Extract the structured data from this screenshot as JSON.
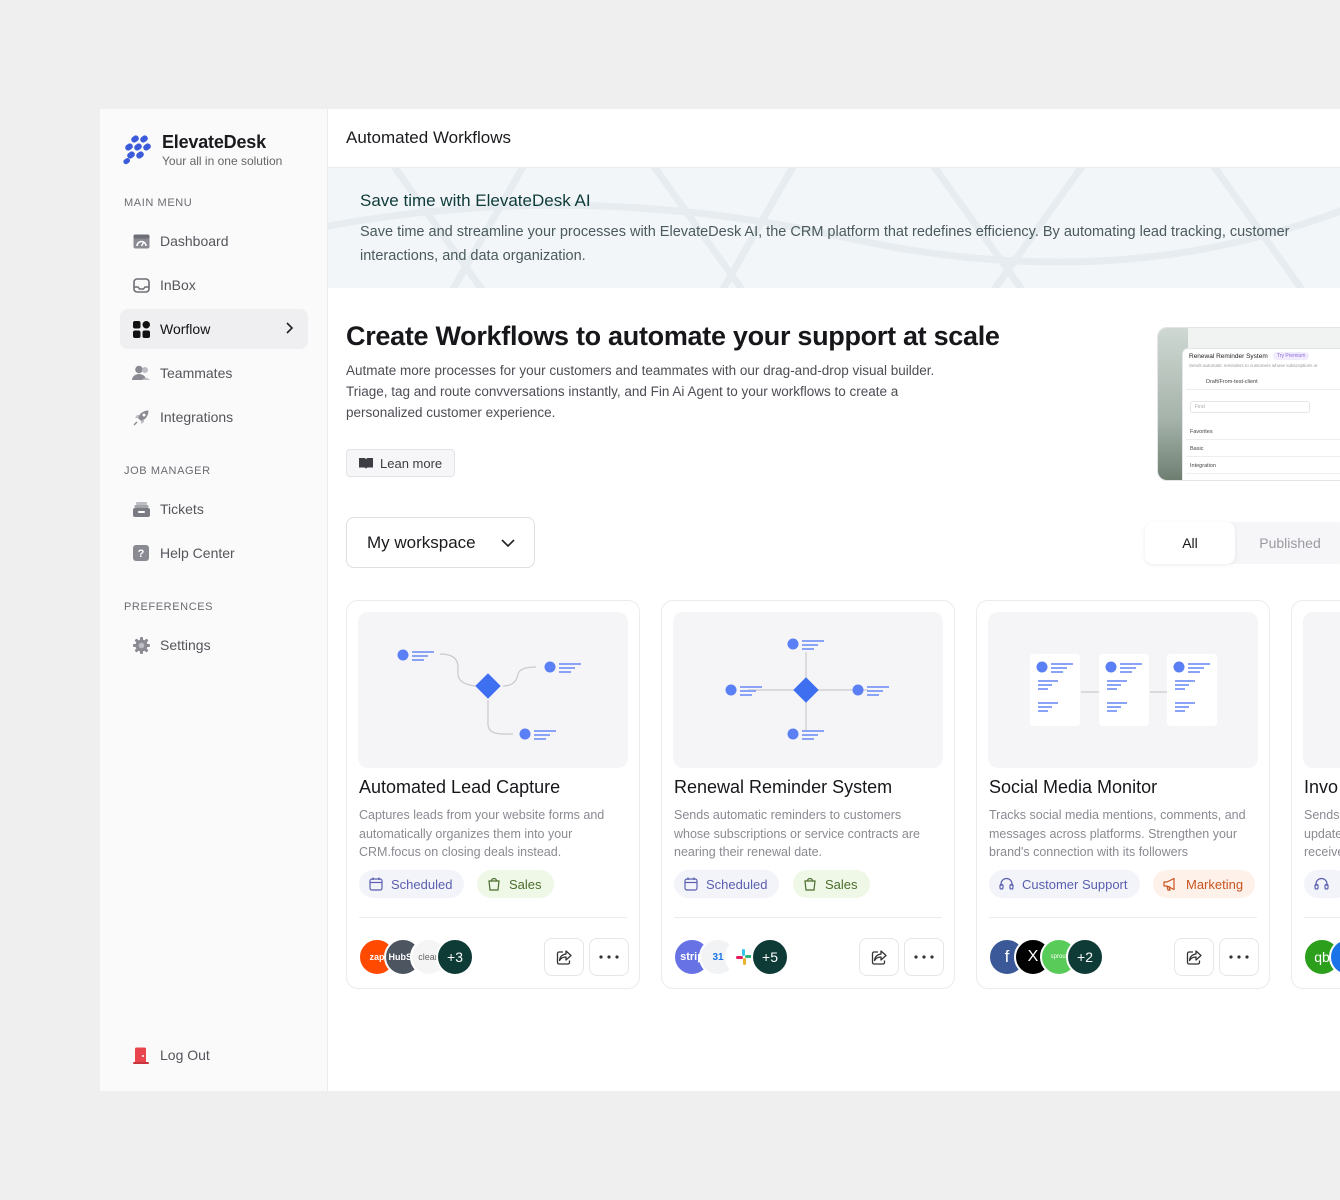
{
  "brand": {
    "name": "ElevateDesk",
    "tagline": "Your all in one solution",
    "accent": "#3b5bdb"
  },
  "sidebar": {
    "sections": [
      {
        "title": "MAIN MENU"
      },
      {
        "title": "JOB MANAGER"
      },
      {
        "title": "PREFERENCES"
      }
    ],
    "items": [
      {
        "label": "Dashboard",
        "icon": "dashboard-icon"
      },
      {
        "label": "InBox",
        "icon": "inbox-icon"
      },
      {
        "label": "Worflow",
        "icon": "workflow-grid-icon",
        "active": true
      },
      {
        "label": "Teammates",
        "icon": "users-icon"
      },
      {
        "label": "Integrations",
        "icon": "rocket-icon"
      },
      {
        "label": "Tickets",
        "icon": "tickets-icon"
      },
      {
        "label": "Help Center",
        "icon": "help-icon"
      },
      {
        "label": "Settings",
        "icon": "gear-icon"
      }
    ],
    "logout": {
      "label": "Log Out",
      "icon": "logout-door-icon"
    }
  },
  "header": {
    "title": "Automated Workflows"
  },
  "banner": {
    "title": "Save time with ElevateDesk AI",
    "text": "Save time and streamline your processes with ElevateDesk AI, the CRM platform that redefines efficiency. By automating lead tracking, customer interactions, and data organization."
  },
  "hero": {
    "title": "Create Workflows to automate your support at scale",
    "text": "Autmate more processes for your customers and teammates with our drag-and-drop visual builder. Triage, tag and route convversations instantly, and Fin Ai Agent to your workflows to create a personalized customer experience.",
    "learn_label": "Lean more"
  },
  "preview": {
    "title": "Renewal Reminder System",
    "badge": "Try Premium",
    "subtitle": "Sends automatic reminders to customers whose subscriptions or",
    "draft": "Draft/From-test-client",
    "find": "Find",
    "rows": [
      "Favorites",
      "Basic",
      "Integration"
    ]
  },
  "workspace": {
    "selected": "My workspace"
  },
  "tabs": {
    "all": "All",
    "published": "Published"
  },
  "cards": [
    {
      "title": "Automated Lead Capture",
      "desc": "Captures leads from your website forms and automatically organizes them into your CRM.focus on closing deals instead.",
      "tags": [
        "Scheduled",
        "Sales"
      ],
      "avatars": [
        "zap",
        "HubSp",
        "clean"
      ],
      "more": "+3"
    },
    {
      "title": "Renewal Reminder System",
      "desc": "Sends automatic reminders to customers whose subscriptions or service contracts are nearing their renewal date.",
      "tags": [
        "Scheduled",
        "Sales"
      ],
      "avatars": [
        "strip",
        "31",
        ""
      ],
      "more": "+5"
    },
    {
      "title": "Social Media Monitor",
      "desc": "Tracks social media mentions, comments, and messages across platforms. Strengthen your brand's connection with its followers",
      "tags": [
        "Customer Support",
        "Marketing"
      ],
      "avatars": [
        "f",
        "X",
        "sprout"
      ],
      "more": "+2"
    },
    {
      "title": "Invo",
      "desc": "Sends update receive",
      "avatars": [
        "qb",
        "s"
      ]
    }
  ]
}
